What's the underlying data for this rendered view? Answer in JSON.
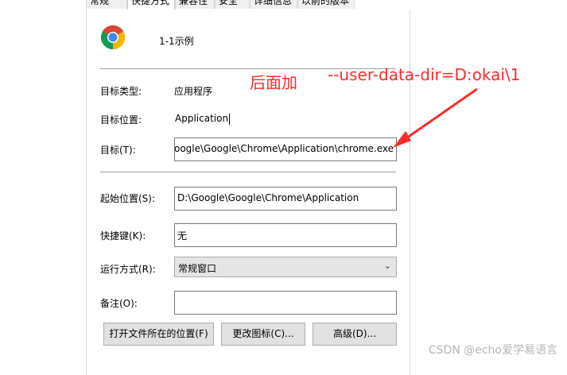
{
  "tabs": [
    "常规",
    "快捷方式",
    "兼容性",
    "安全",
    "详细信息",
    "以前的版本"
  ],
  "shortcut": {
    "name": "1-1示例"
  },
  "rows": {
    "target_type": {
      "label": "目标类型:",
      "value": "应用程序"
    },
    "target_location": {
      "label": "目标位置:",
      "value": "Application"
    },
    "target": {
      "label": "目标(T):",
      "value": "oogle\\Google\\Chrome\\Application\\chrome.exe"
    },
    "start_in": {
      "label": "起始位置(S):",
      "value": "D:\\Google\\Google\\Chrome\\Application"
    },
    "shortcut_key": {
      "label": "快捷键(K):",
      "value": "无"
    },
    "run": {
      "label": "运行方式(R):",
      "value": "常规窗口"
    },
    "comment": {
      "label": "备注(O):",
      "value": ""
    }
  },
  "buttons": {
    "open_location": "打开文件所在的位置(F)",
    "change_icon": "更改图标(C)...",
    "advanced": "高级(D)..."
  },
  "annotation": {
    "left_text": "后面加",
    "right_text": "--user-data-dir=D:okai\\1",
    "color": "#ff2a2a"
  },
  "watermark": "CSDN @echo爱学易语言"
}
